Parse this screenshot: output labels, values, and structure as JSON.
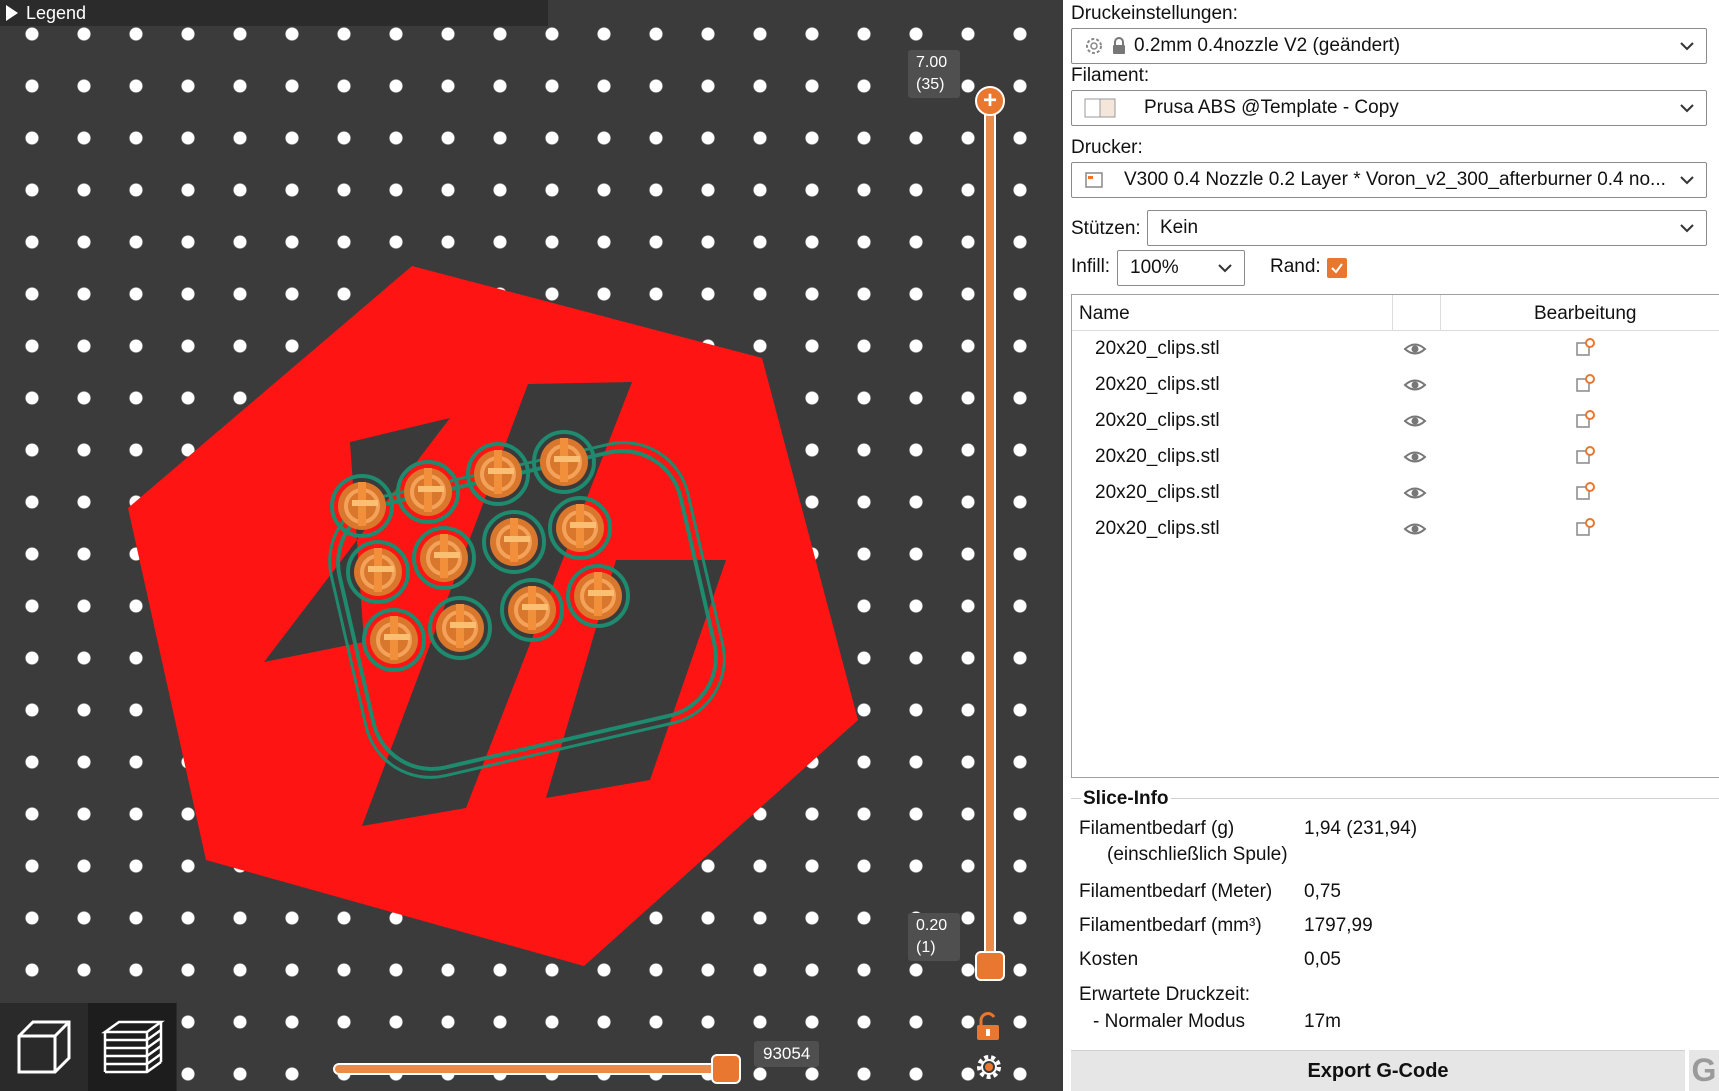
{
  "viewport": {
    "legend_label": "Legend",
    "layer_slider": {
      "top_value": "7.00",
      "top_layer": "(35)",
      "bottom_value": "0.20",
      "bottom_layer": "(1)"
    },
    "move_slider": {
      "value": "93054",
      "position": 1.0
    },
    "colors": {
      "bed": "#ff0000",
      "track": "#e98b4b",
      "accent": "#e9772f",
      "skirt": "#1e8a6e"
    },
    "icons": [
      "lock-open-icon",
      "settings-cog-icon",
      "3d-view-icon",
      "preview-layers-icon"
    ]
  },
  "panel": {
    "print_settings_label": "Druckeinstellungen:",
    "print_settings_value": "0.2mm 0.4nozzle V2 (geändert)",
    "filament_label": "Filament:",
    "filament_value": "Prusa ABS @Template - Copy",
    "printer_label": "Drucker:",
    "printer_value": "V300 0.4 Nozzle 0.2 Layer * Voron_v2_300_afterburner 0.4 no...",
    "supports_label": "Stützen:",
    "supports_value": "Kein",
    "infill_label": "Infill:",
    "infill_value": "100%",
    "brim_label": "Rand:",
    "brim_checked": true,
    "objects": {
      "col_name": "Name",
      "col_edit": "Bearbeitung",
      "rows": [
        "20x20_clips.stl",
        "20x20_clips.stl",
        "20x20_clips.stl",
        "20x20_clips.stl",
        "20x20_clips.stl",
        "20x20_clips.stl"
      ]
    },
    "slice_info": {
      "title": "Slice-Info",
      "filament_g_label": "Filamentbedarf (g)",
      "filament_g_sub": "(einschließlich Spule)",
      "filament_g_value": "1,94 (231,94)",
      "filament_m_label": "Filamentbedarf (Meter)",
      "filament_m_value": "0,75",
      "filament_mm3_label": "Filamentbedarf (mm³)",
      "filament_mm3_value": "1797,99",
      "cost_label": "Kosten",
      "cost_value": "0,05",
      "time_label": "Erwartete Druckzeit:",
      "time_mode_label": "- Normaler Modus",
      "time_mode_value": "17m"
    },
    "export_label": "Export G-Code",
    "g_label": "G"
  }
}
